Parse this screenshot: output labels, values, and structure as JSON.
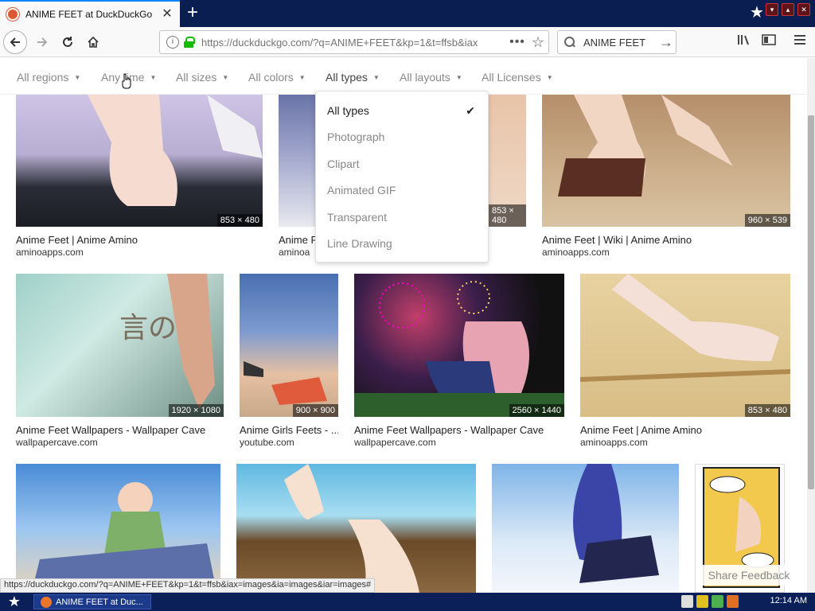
{
  "browser": {
    "tab_title": "ANIME FEET at DuckDuckGo",
    "tab_close": "✕",
    "new_tab": "+",
    "url": "https://duckduckgo.com/?q=ANIME+FEET&kp=1&t=ffsb&iax",
    "url_more": "•••",
    "search_value": "ANIME FEET",
    "status_url": "https://duckduckgo.com/?q=ANIME+FEET&kp=1&t=ffsb&iax=images&ia=images&iar=images#"
  },
  "filters": [
    {
      "label": "All regions"
    },
    {
      "label": "Any time"
    },
    {
      "label": "All sizes"
    },
    {
      "label": "All colors"
    },
    {
      "label": "All types"
    },
    {
      "label": "All layouts"
    },
    {
      "label": "All Licenses"
    }
  ],
  "dropdown": {
    "items": [
      "All types",
      "Photograph",
      "Clipart",
      "Animated GIF",
      "Transparent",
      "Line Drawing"
    ],
    "selected": "All types",
    "check": "✔"
  },
  "results": [
    {
      "title": "Anime Feet | Anime Amino",
      "domain": "aminoapps.com",
      "dims": "853 × 480"
    },
    {
      "title": "Anime F",
      "domain": "aminoa",
      "dims": "853 × 480"
    },
    {
      "title": "Anime Feet | Wiki | Anime Amino",
      "domain": "aminoapps.com",
      "dims": "960 × 539"
    },
    {
      "title": "Anime Feet Wallpapers - Wallpaper Cave",
      "domain": "wallpapercave.com",
      "dims": "1920 × 1080"
    },
    {
      "title": "Anime Girls Feets - ...",
      "domain": "youtube.com",
      "dims": "900 × 900"
    },
    {
      "title": "Anime Feet Wallpapers - Wallpaper Cave",
      "domain": "wallpapercave.com",
      "dims": "2560 × 1440"
    },
    {
      "title": "Anime Feet | Anime Amino",
      "domain": "aminoapps.com",
      "dims": "853 × 480"
    }
  ],
  "feedback_label": "Share Feedback",
  "taskbar": {
    "task_title": "ANIME FEET at Duc...",
    "clock": "12:14 AM"
  },
  "colors": {
    "accent": "#0a84ff",
    "duckduckgo": "#de5833",
    "taskbar": "#0b1f58",
    "lock": "#12bc00"
  }
}
